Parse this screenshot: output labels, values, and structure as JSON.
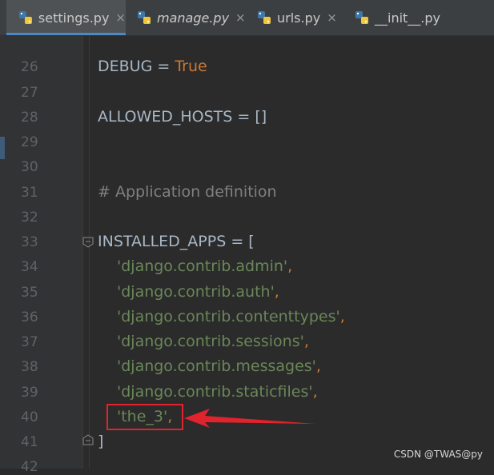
{
  "tabs": [
    {
      "label": "settings.py",
      "italic": false,
      "active": true
    },
    {
      "label": "manage.py",
      "italic": true,
      "active": false
    },
    {
      "label": "urls.py",
      "italic": false,
      "active": false
    },
    {
      "label": "__init__.py",
      "italic": false,
      "active": false
    }
  ],
  "tab_close_glyph": "×",
  "line_numbers": [
    "26",
    "27",
    "28",
    "29",
    "30",
    "31",
    "32",
    "33",
    "34",
    "35",
    "36",
    "37",
    "38",
    "39",
    "40",
    "41",
    "42"
  ],
  "code": {
    "l26": {
      "name": "DEBUG",
      "op": " = ",
      "value": "True"
    },
    "l28": {
      "text": "ALLOWED_HOSTS = []"
    },
    "l31": {
      "comment": "# Application definition"
    },
    "l33": {
      "text": "INSTALLED_APPS = ["
    },
    "l34": {
      "str": "'django.contrib.admin'",
      "punc": ","
    },
    "l35": {
      "str": "'django.contrib.auth'",
      "punc": ","
    },
    "l36": {
      "str": "'django.contrib.contenttypes'",
      "punc": ","
    },
    "l37": {
      "str": "'django.contrib.sessions'",
      "punc": ","
    },
    "l38": {
      "str": "'django.contrib.messages'",
      "punc": ","
    },
    "l39": {
      "str": "'django.contrib.staticfiles'",
      "punc": ","
    },
    "l40": {
      "str": "'the_3'",
      "punc": ","
    },
    "l41": {
      "text": "]"
    }
  },
  "colors": {
    "background": "#2b2b2b",
    "keyword": "#cc7832",
    "string": "#6a8759",
    "comment": "#808080",
    "identifier": "#a9b7c6",
    "annotation": "#e0232d",
    "active_tab_underline": "#4a88c7"
  },
  "watermark": "CSDN @TWAS@py"
}
